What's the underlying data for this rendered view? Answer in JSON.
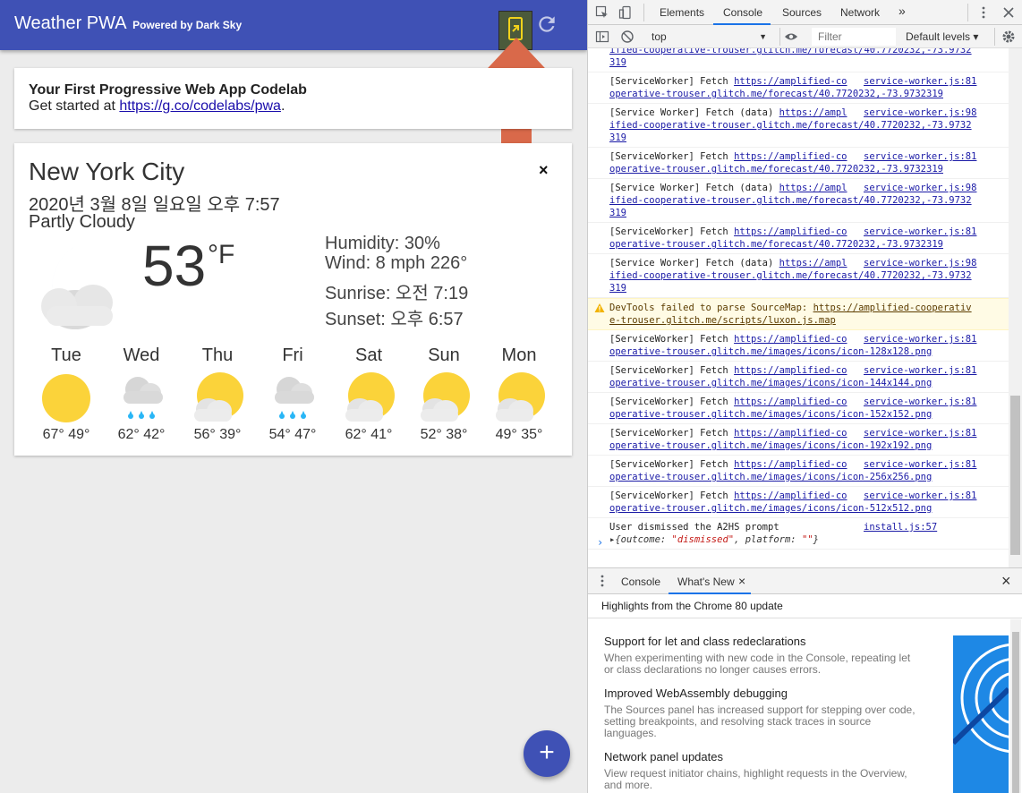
{
  "app": {
    "title": "Weather PWA",
    "subtitle": "Powered by Dark Sky",
    "intro": {
      "title": "Your First Progressive Web App Codelab",
      "prefix": "Get started at ",
      "link": "https://g.co/codelabs/pwa",
      "suffix": "."
    },
    "weather": {
      "city": "New York City",
      "datetime": "2020년 3월 8일 일요일 오후 7:57",
      "conditions": "Partly Cloudy",
      "temperature": "53",
      "unit": "°F",
      "humidity": "Humidity: 30%",
      "wind": "Wind: 8 mph 226°",
      "sunrise": "Sunrise: 오전 7:19",
      "sunset": "Sunset: 오후 6:57",
      "close": "×",
      "forecast": [
        {
          "day": "Tue",
          "icon": "clear-day-icon",
          "temps": "67° 49°"
        },
        {
          "day": "Wed",
          "icon": "rain-icon",
          "temps": "62° 42°"
        },
        {
          "day": "Thu",
          "icon": "partly-cloudy-day-icon",
          "temps": "56° 39°"
        },
        {
          "day": "Fri",
          "icon": "rain-icon",
          "temps": "54° 47°"
        },
        {
          "day": "Sat",
          "icon": "partly-cloudy-day-icon",
          "temps": "62° 41°"
        },
        {
          "day": "Sun",
          "icon": "partly-cloudy-day-icon",
          "temps": "52° 38°"
        },
        {
          "day": "Mon",
          "icon": "partly-cloudy-day-icon",
          "temps": "49° 35°"
        }
      ]
    },
    "fab": "+",
    "colors": {
      "header": "#3f51b5",
      "arrow": "#d9694a",
      "sun": "#fbd33a"
    }
  },
  "devtools": {
    "tabs": [
      "Elements",
      "Console",
      "Sources",
      "Network"
    ],
    "more_tabs": "»",
    "context": "top",
    "filter_placeholder": "Filter",
    "levels": "Default levels ▾",
    "logs": [
      {
        "type": "cut",
        "text": "ified-cooperative-trouser.glitch.me/forecast/40.7720232,-73.9732\n319"
      },
      {
        "type": "fetch",
        "label": "[ServiceWorker] Fetch ",
        "url1": "https://amplified-co",
        "src": "service-worker.js:81",
        "url2": "operative-trouser.glitch.me/forecast/40.7720232,-73.9732319"
      },
      {
        "type": "data",
        "label": "[Service Worker] Fetch (data) ",
        "url1": "https://ampl",
        "src": "service-worker.js:98",
        "url2": "ified-cooperative-trouser.glitch.me/forecast/40.7720232,-73.9732",
        "url3": "319"
      },
      {
        "type": "fetch",
        "label": "[ServiceWorker] Fetch ",
        "url1": "https://amplified-co",
        "src": "service-worker.js:81",
        "url2": "operative-trouser.glitch.me/forecast/40.7720232,-73.9732319"
      },
      {
        "type": "data",
        "label": "[Service Worker] Fetch (data) ",
        "url1": "https://ampl",
        "src": "service-worker.js:98",
        "url2": "ified-cooperative-trouser.glitch.me/forecast/40.7720232,-73.9732",
        "url3": "319"
      },
      {
        "type": "fetch",
        "label": "[ServiceWorker] Fetch ",
        "url1": "https://amplified-co",
        "src": "service-worker.js:81",
        "url2": "operative-trouser.glitch.me/forecast/40.7720232,-73.9732319"
      },
      {
        "type": "data",
        "label": "[Service Worker] Fetch (data) ",
        "url1": "https://ampl",
        "src": "service-worker.js:98",
        "url2": "ified-cooperative-trouser.glitch.me/forecast/40.7720232,-73.9732",
        "url3": "319"
      },
      {
        "type": "warn",
        "label": "DevTools failed to parse SourceMap: ",
        "url1": "https://amplified-cooperativ",
        "url2": "e-trouser.glitch.me/scripts/luxon.js.map"
      },
      {
        "type": "fetch",
        "label": "[ServiceWorker] Fetch ",
        "url1": "https://amplified-co",
        "src": "service-worker.js:81",
        "url2": "operative-trouser.glitch.me/images/icons/icon-128x128.png"
      },
      {
        "type": "fetch",
        "label": "[ServiceWorker] Fetch ",
        "url1": "https://amplified-co",
        "src": "service-worker.js:81",
        "url2": "operative-trouser.glitch.me/images/icons/icon-144x144.png"
      },
      {
        "type": "fetch",
        "label": "[ServiceWorker] Fetch ",
        "url1": "https://amplified-co",
        "src": "service-worker.js:81",
        "url2": "operative-trouser.glitch.me/images/icons/icon-152x152.png"
      },
      {
        "type": "fetch",
        "label": "[ServiceWorker] Fetch ",
        "url1": "https://amplified-co",
        "src": "service-worker.js:81",
        "url2": "operative-trouser.glitch.me/images/icons/icon-192x192.png"
      },
      {
        "type": "fetch",
        "label": "[ServiceWorker] Fetch ",
        "url1": "https://amplified-co",
        "src": "service-worker.js:81",
        "url2": "operative-trouser.glitch.me/images/icons/icon-256x256.png"
      },
      {
        "type": "fetch",
        "label": "[ServiceWorker] Fetch ",
        "url1": "https://amplified-co",
        "src": "service-worker.js:81",
        "url2": "operative-trouser.glitch.me/images/icons/icon-512x512.png"
      },
      {
        "type": "obj",
        "label": "User dismissed the A2HS prompt",
        "src": "install.js:57",
        "obj_prefix": "▸{outcome: ",
        "obj_val1": "\"dismissed\"",
        "obj_mid": ", platform: ",
        "obj_val2": "\"\"",
        "obj_suffix": "}"
      }
    ],
    "prompt": "›",
    "drawer": {
      "tabs": [
        "Console",
        "What's New"
      ],
      "close_tab": "×",
      "close": "×",
      "heading": "Highlights from the Chrome 80 update",
      "items": [
        {
          "title": "Support for let and class redeclarations",
          "desc": "When experimenting with new code in the Console, repeating let or class declarations no longer causes errors."
        },
        {
          "title": "Improved WebAssembly debugging",
          "desc": "The Sources panel has increased support for stepping over code, setting breakpoints, and resolving stack traces in source languages."
        },
        {
          "title": "Network panel updates",
          "desc": "View request initiator chains, highlight requests in the Overview, and more."
        }
      ]
    }
  }
}
